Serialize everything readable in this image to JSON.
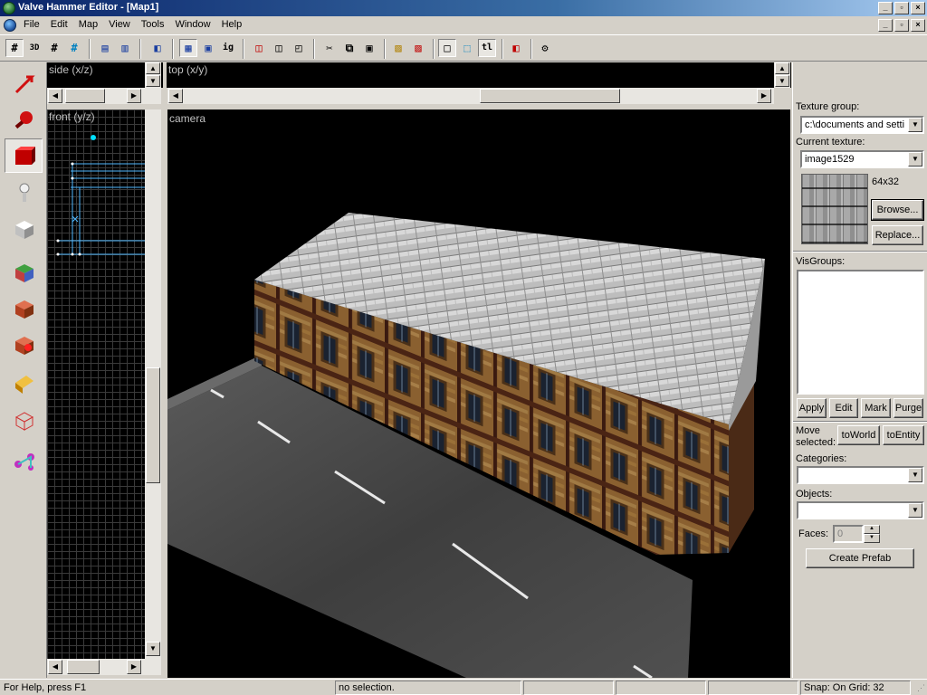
{
  "window": {
    "title": "Valve Hammer Editor - [Map1]",
    "minimize": "_",
    "restore": "▫",
    "close": "×"
  },
  "menu": {
    "items": [
      "File",
      "Edit",
      "Map",
      "View",
      "Tools",
      "Window",
      "Help"
    ]
  },
  "viewports": {
    "side": "side (x/z)",
    "top": "top (x/y)",
    "front": "front (y/z)",
    "camera": "camera"
  },
  "texture_panel": {
    "texture_group_label": "Texture group:",
    "texture_group_value": "c:\\documents and setti",
    "current_texture_label": "Current texture:",
    "current_texture_value": "image1529",
    "texture_size": "64x32",
    "browse": "Browse...",
    "replace": "Replace..."
  },
  "visgroups": {
    "label": "VisGroups:",
    "apply": "Apply",
    "edit": "Edit",
    "mark": "Mark",
    "purge": "Purge"
  },
  "move_selected": {
    "label_line1": "Move",
    "label_line2": "selected:",
    "to_world": "toWorld",
    "to_entity": "toEntity"
  },
  "prefab": {
    "categories_label": "Categories:",
    "categories_value": "",
    "objects_label": "Objects:",
    "objects_value": "",
    "faces_label": "Faces:",
    "faces_value": "0",
    "create_prefab": "Create Prefab"
  },
  "status": {
    "help": "For Help, press F1",
    "selection": "no selection.",
    "snap": "Snap: On Grid: 32"
  },
  "colors": {
    "title_start": "#0a246a",
    "title_end": "#a6caf0",
    "viewport_bg": "#000000",
    "grid": "#3a3a3a",
    "selection": "#00c8ff"
  },
  "icons": {
    "toolbar": [
      "grid-toggle-icon",
      "3d-grid-icon",
      "grid-icon",
      "grid-snap-icon",
      "carve-icon",
      "hollow-icon",
      "group-icon",
      "ungroup-icon",
      "ignore-groups-icon",
      "hide-selected-icon",
      "hide-unselected-icon",
      "show-all-icon",
      "cut-icon",
      "copy-icon",
      "paste-icon",
      "toggle-texlock-icon",
      "toggle-texscale-icon",
      "select-by-handles-icon",
      "select-by-center-icon",
      "texlock-icon",
      "run-map-icon",
      "options-icon"
    ],
    "palette": [
      "selection-tool-icon",
      "magnify-tool-icon",
      "camera-tool-icon",
      "entity-tool-icon",
      "block-tool-icon",
      "texture-application-icon",
      "apply-texture-icon",
      "decal-tool-icon",
      "clipping-tool-icon",
      "vertex-manipulation-icon",
      "path-tool-icon"
    ]
  }
}
